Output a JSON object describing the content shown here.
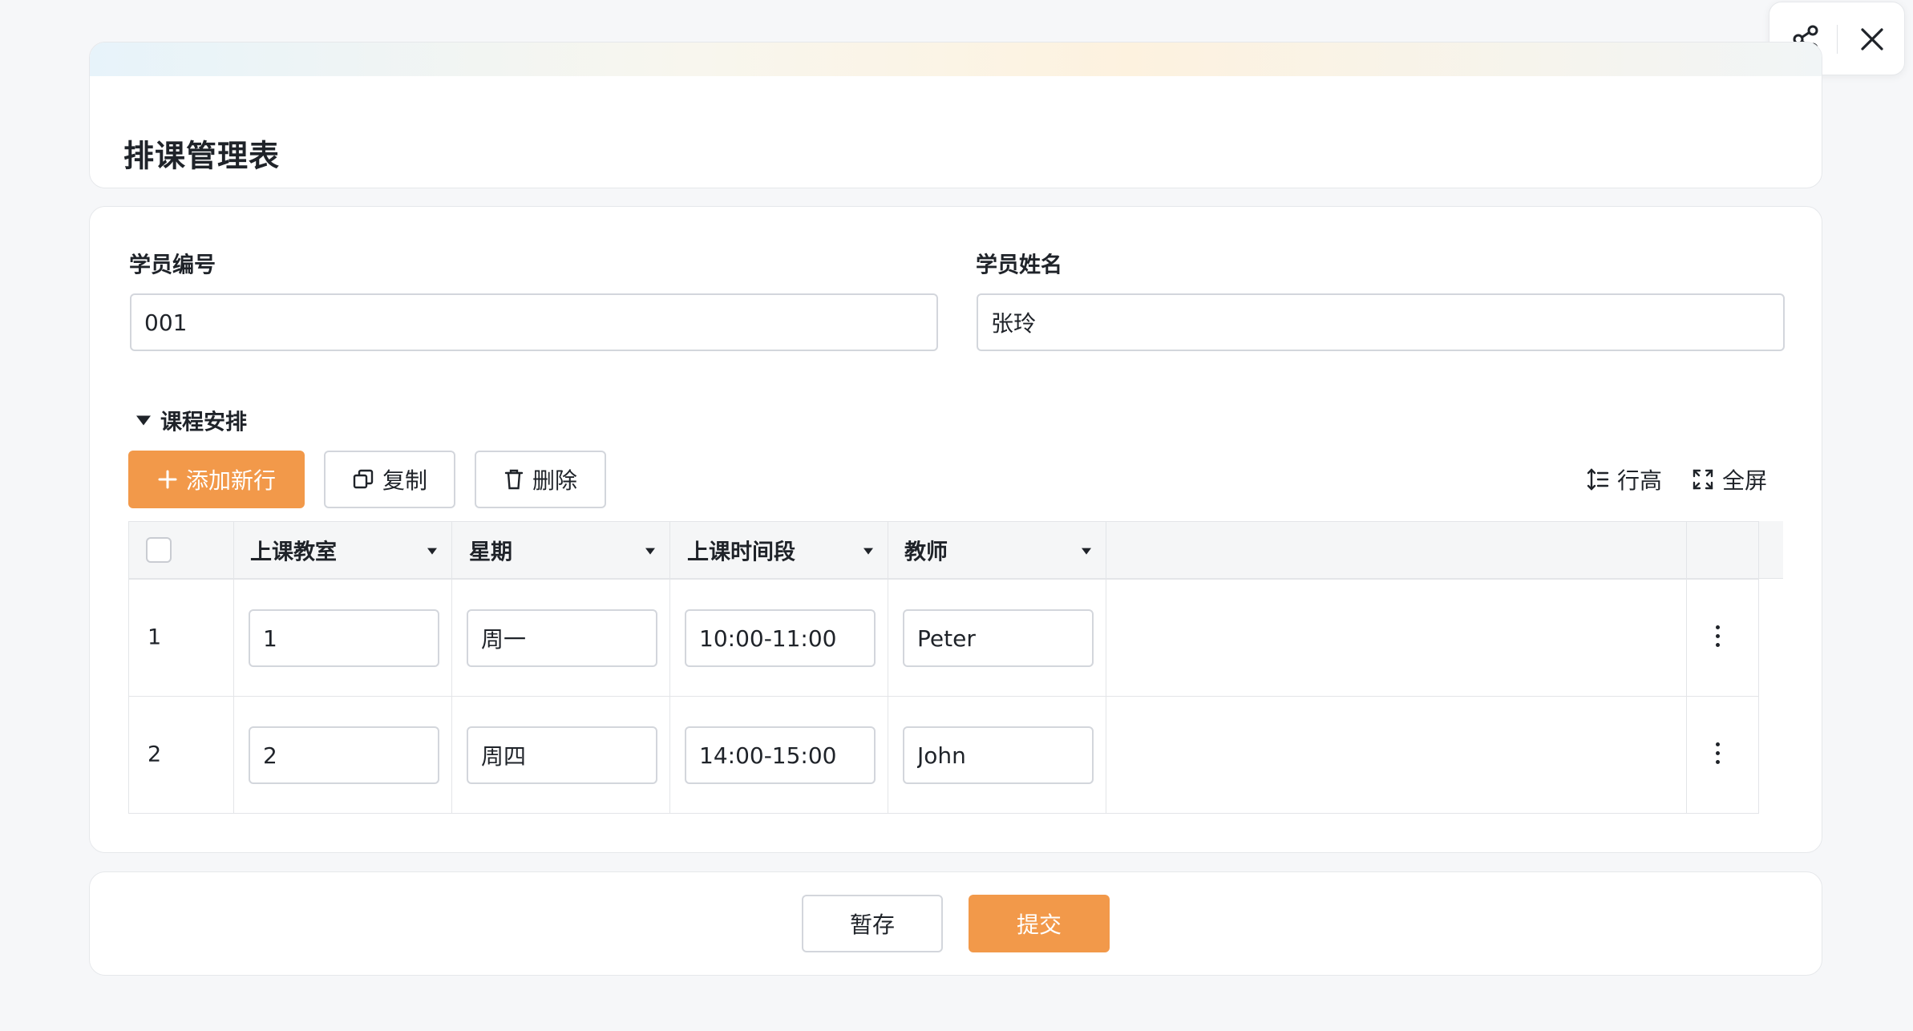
{
  "page": {
    "title": "排课管理表"
  },
  "toolbar_top": {
    "share_icon": "share-icon",
    "close_icon": "close-icon"
  },
  "form": {
    "student_id": {
      "label": "学员编号",
      "value": "001"
    },
    "student_name": {
      "label": "学员姓名",
      "value": "张玲"
    }
  },
  "schedule": {
    "section_title": "课程安排",
    "buttons": {
      "add_row": "添加新行",
      "copy": "复制",
      "delete": "删除"
    },
    "tools": {
      "row_height": "行高",
      "fullscreen": "全屏"
    },
    "columns": [
      "上课教室",
      "星期",
      "上课时间段",
      "教师"
    ],
    "rows": [
      {
        "num": "1",
        "classroom": "1",
        "weekday": "周一",
        "time": "10:00-11:00",
        "teacher": "Peter"
      },
      {
        "num": "2",
        "classroom": "2",
        "weekday": "周四",
        "time": "14:00-15:00",
        "teacher": "John"
      }
    ]
  },
  "footer": {
    "save_draft": "暂存",
    "submit": "提交"
  },
  "colors": {
    "accent": "#f2994a",
    "border": "#d3d6dc",
    "background": "#f6f7f9"
  }
}
